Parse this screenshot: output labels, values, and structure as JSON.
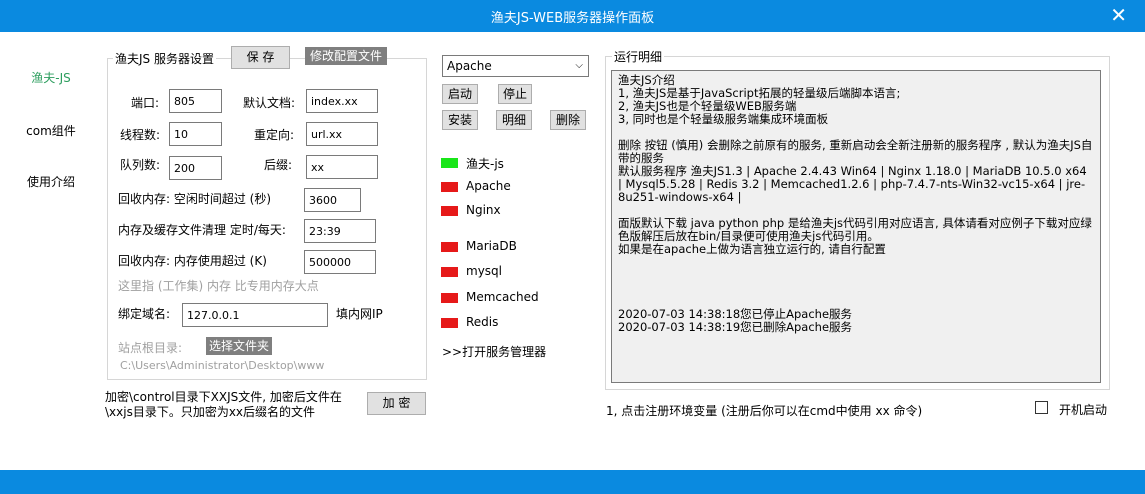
{
  "window": {
    "title": "渔夫JS-WEB服务器操作面板",
    "close_glyph": "✕"
  },
  "nav": [
    "渔夫-JS",
    "com组件",
    "使用介绍"
  ],
  "settings": {
    "legend": "渔夫JS 服务器设置",
    "save_label": "保 存",
    "edit_config_label": "修改配置文件",
    "port_label": "端口:",
    "port_value": "805",
    "default_doc_label": "默认文档:",
    "default_doc_value": "index.xx",
    "threads_label": "线程数:",
    "threads_value": "10",
    "redirect_label": "重定向:",
    "redirect_value": "url.xx",
    "queue_label": "队列数:",
    "queue_value": "200",
    "suffix_label": "后缀:",
    "suffix_value": "xx",
    "idle_label": "回收内存: 空闲时间超过 (秒)",
    "idle_value": "3600",
    "clear_label": "内存及缓存文件清理 定时/每天:",
    "clear_value": "23:39",
    "mem_label": "回收内存: 内存使用超过 (K)",
    "mem_value": "500000",
    "mem_hint": "这里指 (工作集) 内存 比专用内存大点",
    "bind_label": "绑定域名:",
    "bind_value": "127.0.0.1",
    "bind_hint": "填内网IP",
    "root_label": "站点根目录:",
    "choose_folder_label": "选择文件夹",
    "root_value": "C:\\Users\\Administrator\\Desktop\\www"
  },
  "encrypt": {
    "text": "加密\\control目录下XXJS文件, 加密后文件在\\xxjs目录下。只加密为xx后缀名的文件",
    "button_label": "加 密"
  },
  "service_panel": {
    "selected": "Apache",
    "buttons": {
      "start": "启动",
      "stop": "停止",
      "install": "安装",
      "detail": "明细",
      "delete": "删除"
    },
    "services": [
      {
        "name": "渔夫-js",
        "color": "#19e619"
      },
      {
        "name": "Apache",
        "color": "#e61919"
      },
      {
        "name": "Nginx",
        "color": "#e61919"
      },
      {
        "name": "MariaDB",
        "color": "#e61919"
      },
      {
        "name": "mysql",
        "color": "#e61919"
      },
      {
        "name": "Memcached",
        "color": "#e61919"
      },
      {
        "name": "Redis",
        "color": "#e61919"
      }
    ],
    "open_manager": ">>打开服务管理器"
  },
  "log": {
    "legend": "运行明细",
    "lines": [
      "渔夫JS介绍",
      "1, 渔夫JS是基于JavaScript拓展的轻量级后端脚本语言;",
      "2, 渔夫JS也是个轻量级WEB服务端",
      "3, 同时也是个轻量级服务端集成环境面板",
      "",
      "删除 按钮 (慎用) 会删除之前原有的服务, 重新启动会全新注册新的服务程序 , 默认为渔夫JS自带的服务",
      "默认服务程序 渔夫JS1.3 | Apache 2.4.43 Win64 | Nginx 1.18.0 | MariaDB 10.5.0 x64 | Mysql5.5.28 | Redis 3.2 | Memcached1.2.6 | php-7.4.7-nts-Win32-vc15-x64 | jre-8u251-windows-x64 |",
      "",
      "面版默认下载 java python php 是给渔夫js代码引用对应语言, 具体请看对应例子下载对应绿色版解压后放在bin/目录便可使用渔夫js代码引用。",
      "如果是在apache上做为语言独立运行的, 请自行配置",
      "",
      "",
      "",
      "",
      "2020-07-03 14:38:18您已停止Apache服务",
      "2020-07-03 14:38:19您已删除Apache服务"
    ]
  },
  "bottom": {
    "register_text": "1, 点击注册环境变量 (注册后你可以在cmd中使用 xx 命令)",
    "autostart_label": "开机启动"
  }
}
